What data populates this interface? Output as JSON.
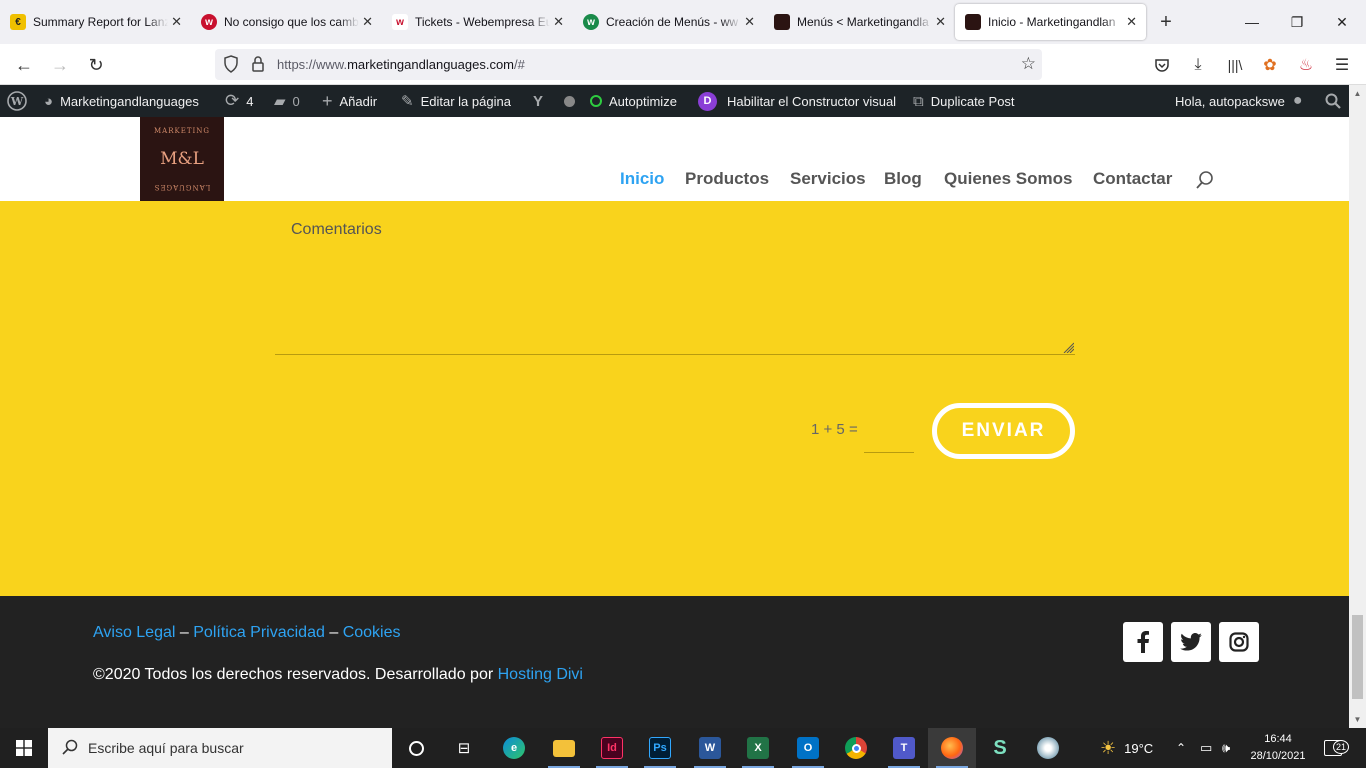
{
  "browser": {
    "tabs": [
      {
        "label": "Summary Report for Lanz",
        "favicon_color": "#f0c000",
        "favicon_glyph": "€"
      },
      {
        "label": "No consigo que los camb",
        "favicon_color": "#c8102e",
        "favicon_glyph": "w"
      },
      {
        "label": "Tickets - Webempresa Eu",
        "favicon_color": "#ffffff",
        "favicon_glyph": "w"
      },
      {
        "label": "Creación de Menús - ww",
        "favicon_color": "#1a8a4a",
        "favicon_glyph": "w"
      },
      {
        "label": "Menús < Marketingandla",
        "favicon_color": "#2b1412",
        "favicon_glyph": ""
      },
      {
        "label": "Inicio - Marketingandlan",
        "favicon_color": "#2b1412",
        "favicon_glyph": ""
      }
    ],
    "url_prefix": "https://www.",
    "url_domain": "marketingandlanguages.com",
    "url_suffix": "/#"
  },
  "wp_admin_bar": {
    "site_name": "Marketingandlanguages",
    "updates_count": "4",
    "comments_count": "0",
    "add_new": "Añadir",
    "edit_page": "Editar la página",
    "autoptimize": "Autoptimize",
    "visual_builder": "Habilitar el Constructor visual",
    "duplicate_post": "Duplicate Post",
    "greeting": "Hola, autopackswe"
  },
  "site": {
    "logo": {
      "top_text": "MARKETING",
      "main": "M&L",
      "bottom_text": "LANGUAGES"
    },
    "menu": [
      "Inicio",
      "Productos",
      "Servicios",
      "Blog",
      "Quienes Somos",
      "Contactar"
    ],
    "active_menu": "Inicio",
    "accent_color": "#2ea3f2",
    "content_bg": "#f9d31c"
  },
  "form": {
    "comments_placeholder": "Comentarios",
    "captcha_question": "1 + 5 =",
    "captcha_value": "",
    "submit_label": "ENVIAR"
  },
  "footer": {
    "link_aviso": "Aviso Legal",
    "link_privacidad": "Política Privacidad",
    "link_cookies": "Cookies",
    "separator": "–",
    "copyright": "©2020 Todos los derechos reservados. Desarrollado por",
    "copyright_link": "Hosting Divi",
    "social": [
      "facebook-icon",
      "twitter-icon",
      "instagram-icon"
    ]
  },
  "taskbar": {
    "search_placeholder": "Escribe aquí para buscar",
    "apps": [
      "cortana-icon",
      "task-view-icon",
      "edge-icon",
      "file-explorer-icon",
      "indesign-icon",
      "photoshop-icon",
      "word-icon",
      "excel-icon",
      "outlook-icon",
      "chrome-icon",
      "teams-icon",
      "firefox-icon",
      "app-s-icon",
      "paint-icon"
    ],
    "temperature": "19°C",
    "time": "16:44",
    "date": "28/10/2021",
    "notifications": "21"
  }
}
